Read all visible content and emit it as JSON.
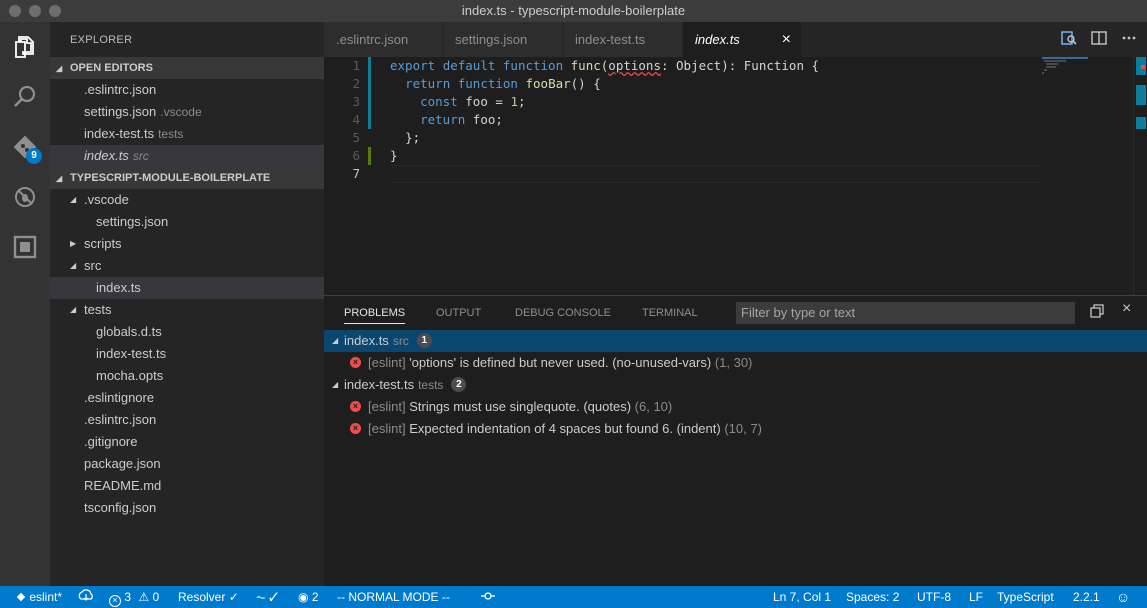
{
  "window": {
    "title": "index.ts - typescript-module-boilerplate"
  },
  "activity": {
    "scm_badge": "9"
  },
  "sidebar": {
    "title": "EXPLORER",
    "open_editors": {
      "header": "OPEN EDITORS",
      "items": [
        {
          "label": ".eslintrc.json",
          "desc": ""
        },
        {
          "label": "settings.json",
          "desc": ".vscode"
        },
        {
          "label": "index-test.ts",
          "desc": "tests"
        },
        {
          "label": "index.ts",
          "desc": "src"
        }
      ]
    },
    "project": {
      "header": "TYPESCRIPT-MODULE-BOILERPLATE",
      "items": [
        {
          "label": ".vscode"
        },
        {
          "label": "settings.json"
        },
        {
          "label": "scripts"
        },
        {
          "label": "src"
        },
        {
          "label": "index.ts"
        },
        {
          "label": "tests"
        },
        {
          "label": "globals.d.ts"
        },
        {
          "label": "index-test.ts"
        },
        {
          "label": "mocha.opts"
        },
        {
          "label": ".eslintignore"
        },
        {
          "label": ".eslintrc.json"
        },
        {
          "label": ".gitignore"
        },
        {
          "label": "package.json"
        },
        {
          "label": "README.md"
        },
        {
          "label": "tsconfig.json"
        }
      ]
    }
  },
  "tabs": [
    {
      "label": ".eslintrc.json"
    },
    {
      "label": "settings.json"
    },
    {
      "label": "index-test.ts"
    },
    {
      "label": "index.ts",
      "close": "×"
    }
  ],
  "editor": {
    "line_numbers": [
      "1",
      "2",
      "3",
      "4",
      "5",
      "6",
      "7"
    ],
    "lines": {
      "l1": {
        "kw1": "export",
        "kw2": "default",
        "kw3": "function",
        "fn": "func",
        "p1": "(",
        "param": "options",
        "p2": ": Object): Function {"
      },
      "l2": {
        "kw1": "return",
        "kw2": "function",
        "fn": "fooBar",
        "rest": "() {"
      },
      "l3": {
        "kw": "const",
        "mid": " foo = ",
        "num": "1",
        "end": ";"
      },
      "l4": {
        "kw": "return",
        "rest": " foo;"
      },
      "l5": {
        "text": "};"
      },
      "l6": {
        "text": "}"
      }
    }
  },
  "panel": {
    "tabs": [
      "PROBLEMS",
      "OUTPUT",
      "DEBUG CONSOLE",
      "TERMINAL"
    ],
    "filter_placeholder": "Filter by type or text",
    "problems": [
      {
        "file": "index.ts",
        "dir": "src",
        "count": "1",
        "items": [
          {
            "source": "[eslint]",
            "message": "'options' is defined but never used. (no-unused-vars)",
            "loc": "(1, 30)"
          }
        ]
      },
      {
        "file": "index-test.ts",
        "dir": "tests",
        "count": "2",
        "items": [
          {
            "source": "[eslint]",
            "message": "Strings must use singlequote. (quotes)",
            "loc": "(6, 10)"
          },
          {
            "source": "[eslint]",
            "message": "Expected indentation of 4 spaces but found 6. (indent)",
            "loc": "(10, 7)"
          }
        ]
      }
    ]
  },
  "statusbar": {
    "branch": "eslint*",
    "errors": "3",
    "warnings": "0",
    "resolver": "Resolver",
    "watchers": "2",
    "mode": "-- NORMAL MODE --",
    "position": "Ln 7, Col 1",
    "spaces": "Spaces: 2",
    "encoding": "UTF-8",
    "eol": "LF",
    "language": "TypeScript",
    "version": "2.2.1"
  },
  "colors": {
    "accent": "#007acc",
    "error": "#f14c4c",
    "selection": "#094771"
  }
}
